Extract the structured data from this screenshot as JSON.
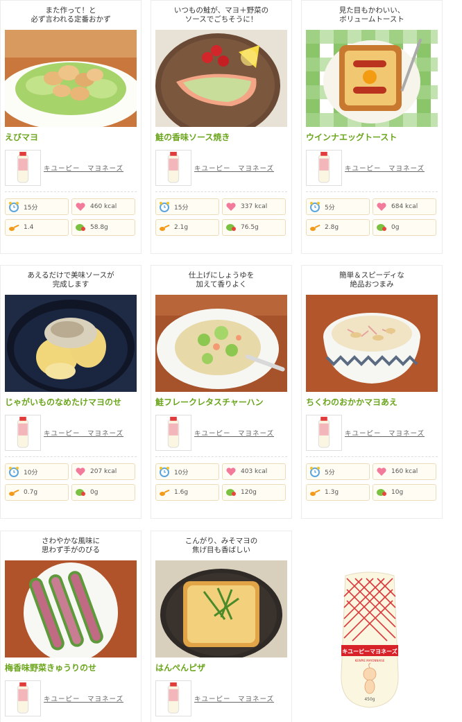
{
  "recipes": [
    {
      "tagline": "また作って！と\n必ず言われる定番おかず",
      "title": "えびマヨ",
      "product": "キユーピー　マヨネーズ",
      "time": "15分",
      "energy": "460 kcal",
      "salt": "1.4",
      "veg": "58.8g"
    },
    {
      "tagline": "いつもの鮭が、マヨ＋野菜の\nソースでごちそうに！",
      "title": "鮭の香味ソース焼き",
      "product": "キユーピー　マヨネーズ",
      "time": "15分",
      "energy": "337 kcal",
      "salt": "2.1g",
      "veg": "76.5g"
    },
    {
      "tagline": "見た目もかわいい、\nボリュームトースト",
      "title": "ウインナエッグトースト",
      "product": "キユーピー　マヨネーズ",
      "time": "5分",
      "energy": "684 kcal",
      "salt": "2.8g",
      "veg": "0g"
    },
    {
      "tagline": "あえるだけで美味ソースが\n完成します",
      "title": "じゃがいものなめたけマヨのせ",
      "product": "キユーピー　マヨネーズ",
      "time": "10分",
      "energy": "207 kcal",
      "salt": "0.7g",
      "veg": "0g"
    },
    {
      "tagline": "仕上げにしょうゆを\n加えて香りよく",
      "title": "鮭フレークレタスチャーハン",
      "product": "キユーピー　マヨネーズ",
      "time": "10分",
      "energy": "403 kcal",
      "salt": "1.6g",
      "veg": "120g"
    },
    {
      "tagline": "簡単＆スピーディな\n絶品おつまみ",
      "title": "ちくわのおかかマヨあえ",
      "product": "キユーピー　マヨネーズ",
      "time": "5分",
      "energy": "160 kcal",
      "salt": "1.3g",
      "veg": "10g"
    },
    {
      "tagline": "さわやかな風味に\n思わず手がのびる",
      "title": "梅香味野菜きゅうりのせ",
      "product": "キユーピー　マヨネーズ",
      "time": "",
      "energy": "",
      "salt": "",
      "veg": ""
    },
    {
      "tagline": "こんがり、みそマヨの\n焦げ目も香ばしい",
      "title": "はんぺんピザ",
      "product": "キユーピー　マヨネーズ",
      "time": "",
      "energy": "",
      "salt": "",
      "veg": ""
    }
  ],
  "featured_product": {
    "brand": "キユーピーマヨネーズ",
    "sub": "KEWPIE MAYONNAISE",
    "size": "450g"
  },
  "colors": {
    "title_green": "#6aa51b",
    "stat_border": "#ecdcb8",
    "bottle_red": "#d8222a"
  }
}
